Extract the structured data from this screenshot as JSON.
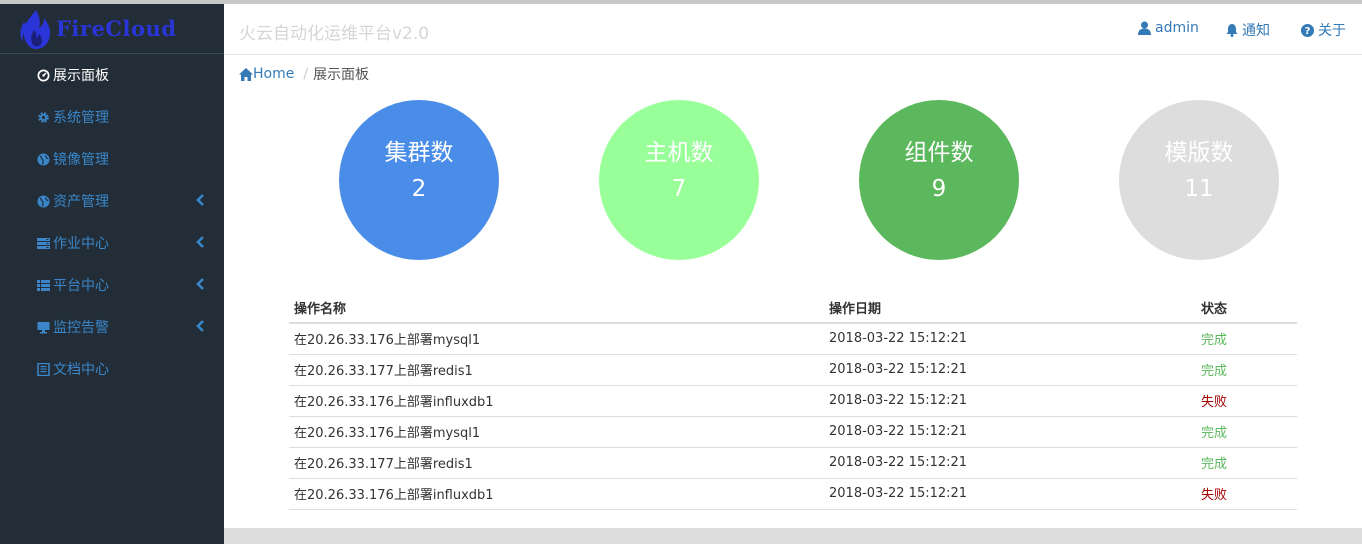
{
  "brand": {
    "name": "FireCloud"
  },
  "header": {
    "title": "火云自动化运维平台v2.0",
    "links": [
      {
        "label": "admin",
        "icon": "user-icon"
      },
      {
        "label": "通知",
        "icon": "bell-icon"
      },
      {
        "label": "关于",
        "icon": "question-circle-icon"
      }
    ]
  },
  "sidebar": {
    "items": [
      {
        "label": "展示面板",
        "icon": "dashboard-icon",
        "active": true,
        "has_submenu": false
      },
      {
        "label": "系统管理",
        "icon": "gear-icon",
        "active": false,
        "has_submenu": false
      },
      {
        "label": "镜像管理",
        "icon": "globe-icon",
        "active": false,
        "has_submenu": false
      },
      {
        "label": "资产管理",
        "icon": "globe-icon",
        "active": false,
        "has_submenu": true
      },
      {
        "label": "作业中心",
        "icon": "server-icon",
        "active": false,
        "has_submenu": true
      },
      {
        "label": "平台中心",
        "icon": "list-icon",
        "active": false,
        "has_submenu": true
      },
      {
        "label": "监控告警",
        "icon": "monitor-icon",
        "active": false,
        "has_submenu": true
      },
      {
        "label": "文档中心",
        "icon": "book-icon",
        "active": false,
        "has_submenu": false
      }
    ]
  },
  "breadcrumb": {
    "home": "Home",
    "current": "展示面板"
  },
  "stats": [
    {
      "label": "集群数",
      "value": "2",
      "color": "#4a8de8"
    },
    {
      "label": "主机数",
      "value": "7",
      "color": "#99ff99"
    },
    {
      "label": "组件数",
      "value": "9",
      "color": "#5cb85c"
    },
    {
      "label": "模版数",
      "value": "11",
      "color": "#dddddd"
    }
  ],
  "table": {
    "headers": [
      "操作名称",
      "操作日期",
      "状态"
    ],
    "rows": [
      {
        "name": "在20.26.33.176上部署mysql1",
        "date": "2018-03-22 15:12:21",
        "status": "完成",
        "ok": true
      },
      {
        "name": "在20.26.33.177上部署redis1",
        "date": "2018-03-22 15:12:21",
        "status": "完成",
        "ok": true
      },
      {
        "name": "在20.26.33.176上部署influxdb1",
        "date": "2018-03-22 15:12:21",
        "status": "失败",
        "ok": false
      },
      {
        "name": "在20.26.33.176上部署mysql1",
        "date": "2018-03-22 15:12:21",
        "status": "完成",
        "ok": true
      },
      {
        "name": "在20.26.33.177上部署redis1",
        "date": "2018-03-22 15:12:21",
        "status": "完成",
        "ok": true
      },
      {
        "name": "在20.26.33.176上部署influxdb1",
        "date": "2018-03-22 15:12:21",
        "status": "失败",
        "ok": false
      }
    ]
  },
  "colors": {
    "sidebar_bg": "#222d38",
    "link": "#337ab7",
    "ok": "#5cb85c",
    "fail": "#a50000"
  }
}
